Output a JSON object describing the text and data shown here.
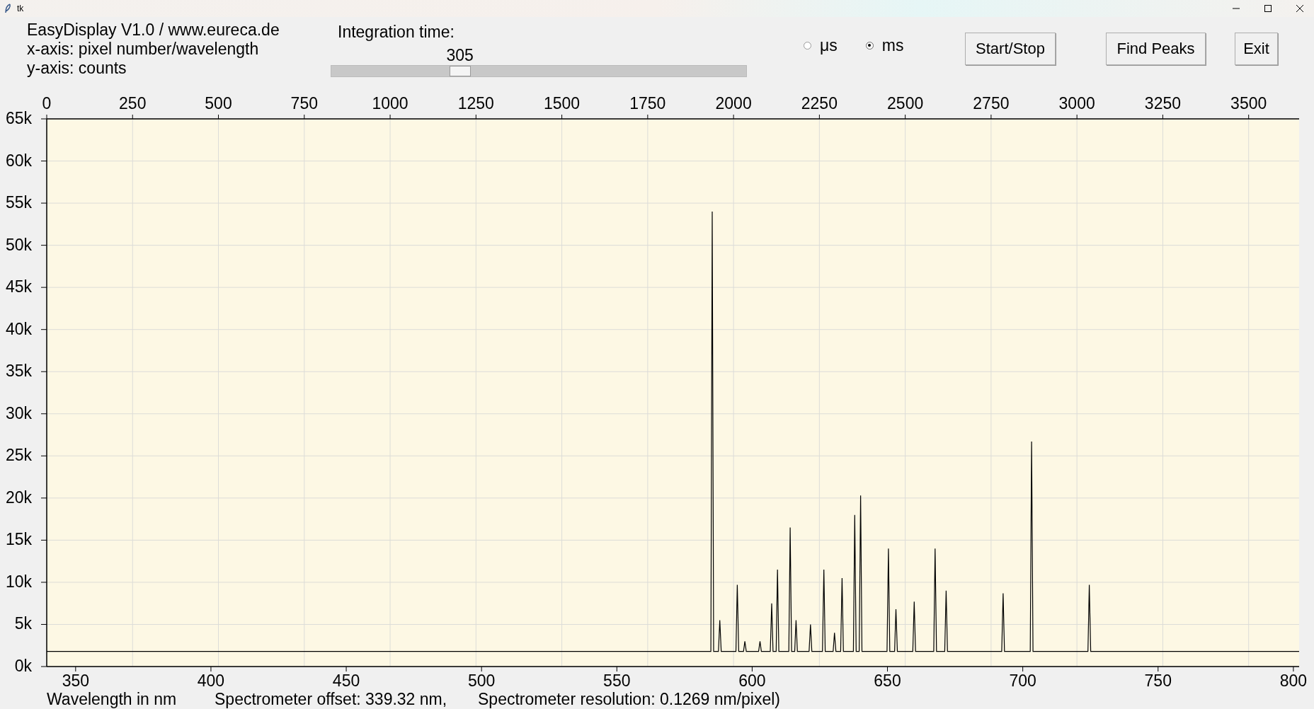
{
  "window": {
    "title": "tk"
  },
  "header": {
    "lines": [
      "EasyDisplay V1.0 / www.eureca.de",
      "x-axis: pixel number/wavelength",
      "y-axis: counts"
    ]
  },
  "integration": {
    "label": "Integration time:",
    "value": "305",
    "level": 0.31
  },
  "units": [
    {
      "label": "μs",
      "selected": false
    },
    {
      "label": "ms",
      "selected": true
    }
  ],
  "buttons": [
    "Start/Stop",
    "Find Peaks",
    "Exit"
  ],
  "plot": {
    "chart_data": {
      "type": "line",
      "grid": true,
      "xlim": [
        0,
        3647
      ],
      "ylim": [
        0,
        65000
      ],
      "xticks": [
        0,
        250,
        500,
        750,
        1000,
        1250,
        1500,
        1750,
        2000,
        2250,
        2500,
        2750,
        3000,
        3250,
        3500
      ],
      "yticks": [
        {
          "value": 0,
          "label": "0k"
        },
        {
          "value": 5000,
          "label": "5k"
        },
        {
          "value": 10000,
          "label": "10k"
        },
        {
          "value": 15000,
          "label": "15k"
        },
        {
          "value": 20000,
          "label": "20k"
        },
        {
          "value": 25000,
          "label": "25k"
        },
        {
          "value": 30000,
          "label": "30k"
        },
        {
          "value": 35000,
          "label": "35k"
        },
        {
          "value": 40000,
          "label": "40k"
        },
        {
          "value": 45000,
          "label": "45k"
        },
        {
          "value": 50000,
          "label": "50k"
        },
        {
          "value": 55000,
          "label": "55k"
        },
        {
          "value": 60000,
          "label": "60k"
        },
        {
          "value": 65000,
          "label": "65k"
        }
      ],
      "x": [
        0,
        1934,
        1938,
        1942,
        1956,
        1960,
        1964,
        2007,
        2011,
        2015,
        2029,
        2033,
        2037,
        2073,
        2077,
        2081,
        2107,
        2111,
        2115,
        2124,
        2128,
        2132,
        2161,
        2165,
        2169,
        2178,
        2182,
        2186,
        2220,
        2224,
        2228,
        2259,
        2263,
        2267,
        2290,
        2294,
        2298,
        2312,
        2316,
        2320,
        2349,
        2353,
        2357,
        2366,
        2370,
        2374,
        2447,
        2451,
        2455,
        2469,
        2473,
        2477,
        2522,
        2526,
        2530,
        2583,
        2587,
        2591,
        2615,
        2619,
        2623,
        2781,
        2785,
        2789,
        2864,
        2868,
        2872,
        3032,
        3036,
        3040,
        3647
      ],
      "series": [
        {
          "color": "#000000",
          "values": [
            1800,
            1800,
            54000,
            1800,
            1800,
            5500,
            1800,
            1800,
            9700,
            1800,
            1800,
            3000,
            1800,
            1800,
            3000,
            1800,
            1800,
            7500,
            1800,
            1800,
            11500,
            1800,
            1800,
            16500,
            1800,
            1800,
            5500,
            1800,
            1800,
            5000,
            1800,
            1800,
            11500,
            1800,
            1800,
            4000,
            1800,
            1800,
            10500,
            1800,
            1800,
            18000,
            1800,
            1800,
            20300,
            1800,
            1800,
            14000,
            1800,
            1800,
            6800,
            1800,
            1800,
            7700,
            1800,
            1800,
            14000,
            1800,
            1800,
            9000,
            1800,
            1800,
            8700,
            1800,
            1800,
            26700,
            1800,
            1800,
            9700,
            1800,
            1800
          ]
        }
      ]
    },
    "wavelength_ticks": [
      "350",
      "400",
      "450",
      "500",
      "550",
      "600",
      "650",
      "700",
      "750",
      "800"
    ]
  },
  "footer": [
    "Wavelength in nm",
    "Spectrometer offset: 339.32 nm,",
    "Spectrometer resolution: 0.1269 nm/pixel)"
  ]
}
